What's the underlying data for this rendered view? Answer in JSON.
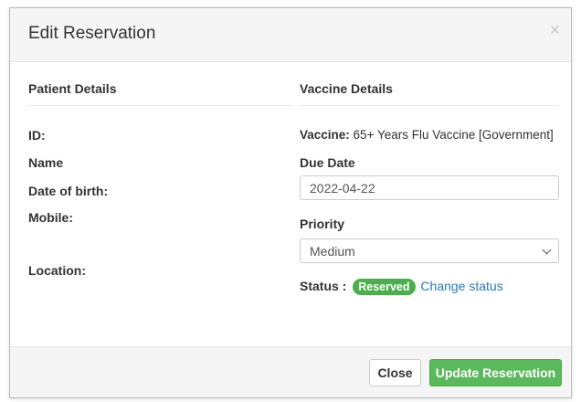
{
  "modal": {
    "title": "Edit Reservation",
    "close_glyph": "×"
  },
  "patient": {
    "heading": "Patient Details",
    "id_label": "ID:",
    "name_label": "Name",
    "dob_label": "Date of birth:",
    "mobile_label": "Mobile:",
    "location_label": "Location:"
  },
  "vaccine": {
    "heading": "Vaccine Details",
    "vaccine_label": "Vaccine:",
    "vaccine_value": " 65+ Years Flu Vaccine [Government]",
    "due_date_label": "Due Date",
    "due_date_value": "2022-04-22",
    "priority_label": "Priority",
    "priority_value": "Medium",
    "status_label": "Status :",
    "status_badge": "Reserved",
    "change_status_link": "Change status"
  },
  "footer": {
    "close_label": "Close",
    "update_label": "Update Reservation"
  },
  "colors": {
    "success": "#5cb85c",
    "badge": "#4cae4c",
    "link": "#2a7ab8"
  },
  "icons": {
    "close": "close-icon",
    "dropdown": "chevron-down-icon"
  }
}
